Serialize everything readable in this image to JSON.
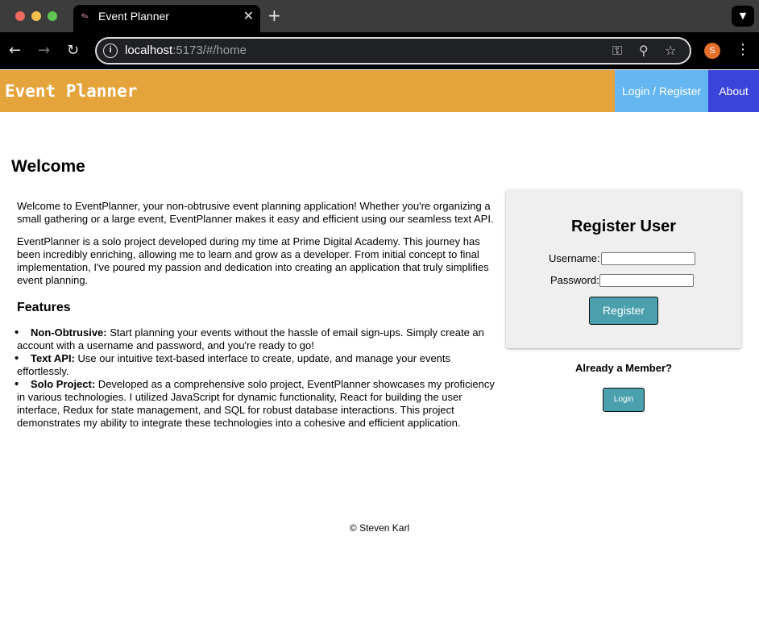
{
  "browser": {
    "tab_title": "Event Planner",
    "tab_close": "✕",
    "new_tab": "+",
    "url_host": "localhost",
    "url_rest": ":5173/#/home",
    "profile_initial": "S",
    "icons": [
      "back-icon",
      "forward-icon",
      "reload-icon",
      "info-icon",
      "key-icon",
      "zoom-icon",
      "star-icon",
      "kebab-menu-icon",
      "tab-menu-icon"
    ]
  },
  "nav": {
    "brand": "Event Planner",
    "login_register": "Login / Register",
    "about": "About",
    "colors": {
      "bar": "#e5a33b",
      "login": "#66b7f1",
      "about": "#3a44da"
    }
  },
  "main": {
    "title": "Welcome",
    "intro": "Welcome to EventPlanner, your non-obtrusive event planning application! Whether you're organizing a small gathering or a large event, EventPlanner makes it easy and efficient using our seamless text API.",
    "about": "EventPlanner is a solo project developed during my time at Prime Digital Academy. This journey has been incredibly enriching, allowing me to learn and grow as a developer. From initial concept to final implementation, I've poured my passion and dedication into creating an application that truly simplifies event planning.",
    "features_heading": "Features",
    "features": [
      {
        "name": "Non-Obtrusive:",
        "text": " Start planning your events without the hassle of email sign-ups. Simply create an account with a username and password, and you're ready to go!"
      },
      {
        "name": "Text API:",
        "text": " Use our intuitive text-based interface to create, update, and manage your events effortlessly."
      },
      {
        "name": "Solo Project:",
        "text": " Developed as a comprehensive solo project, EventPlanner showcases my proficiency in various technologies. I utilized JavaScript for dynamic functionality, React for building the user interface, Redux for state management, and SQL for robust database interactions. This project demonstrates my ability to integrate these technologies into a cohesive and efficient application."
      }
    ]
  },
  "register": {
    "title": "Register User",
    "username_label": "Username:",
    "username_value": "",
    "password_label": "Password:",
    "password_value": "",
    "button": "Register",
    "button_color": "#4aa0ad"
  },
  "member": {
    "heading": "Already a Member?",
    "login_button": "Login"
  },
  "footer": {
    "text": "© Steven Karl"
  }
}
